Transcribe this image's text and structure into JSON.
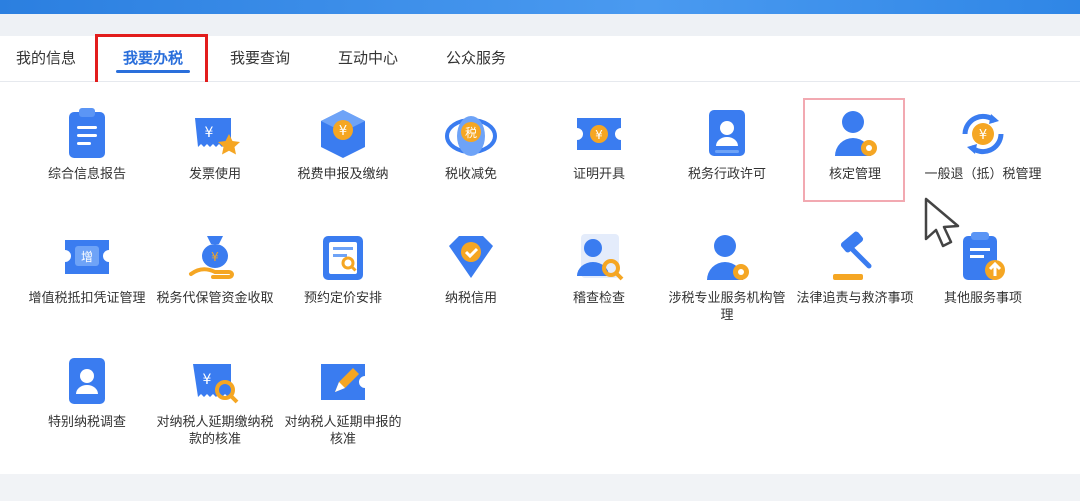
{
  "tabs": [
    {
      "label": "我的信息"
    },
    {
      "label": "我要办税"
    },
    {
      "label": "我要查询"
    },
    {
      "label": "互动中心"
    },
    {
      "label": "公众服务"
    }
  ],
  "services": [
    {
      "label": "综合信息报告",
      "icon": "clipboard-report-icon"
    },
    {
      "label": "发票使用",
      "icon": "invoice-star-icon"
    },
    {
      "label": "税费申报及缴纳",
      "icon": "tax-cube-icon"
    },
    {
      "label": "税收减免",
      "icon": "tax-reduction-icon"
    },
    {
      "label": "证明开具",
      "icon": "certificate-ticket-icon"
    },
    {
      "label": "税务行政许可",
      "icon": "admin-permit-icon"
    },
    {
      "label": "核定管理",
      "icon": "user-gear-icon"
    },
    {
      "label": "一般退（抵）税管理",
      "icon": "refund-cycle-icon"
    },
    {
      "label": "增值税抵扣凭证管理",
      "icon": "vat-voucher-icon"
    },
    {
      "label": "税务代保管资金收取",
      "icon": "money-bag-hand-icon"
    },
    {
      "label": "预约定价安排",
      "icon": "document-search-icon"
    },
    {
      "label": "纳税信用",
      "icon": "credit-diamond-icon"
    },
    {
      "label": "稽查检查",
      "icon": "user-search-icon"
    },
    {
      "label": "涉税专业服务机构管理",
      "icon": "agency-gear-icon"
    },
    {
      "label": "法律追责与救济事项",
      "icon": "gavel-icon"
    },
    {
      "label": "其他服务事项",
      "icon": "clipboard-upload-icon"
    },
    {
      "label": "特别纳税调查",
      "icon": "special-investigation-icon"
    },
    {
      "label": "对纳税人延期缴纳税款的核准",
      "icon": "deferred-payment-icon"
    },
    {
      "label": "对纳税人延期申报的核准",
      "icon": "deferred-declaration-icon"
    }
  ],
  "colors": {
    "accent": "#2a6fdb",
    "highlight_red": "#e21c1c",
    "highlight_pink": "#f2a9b1",
    "icon_blue": "#3a7cf0",
    "icon_orange": "#f5a623"
  }
}
